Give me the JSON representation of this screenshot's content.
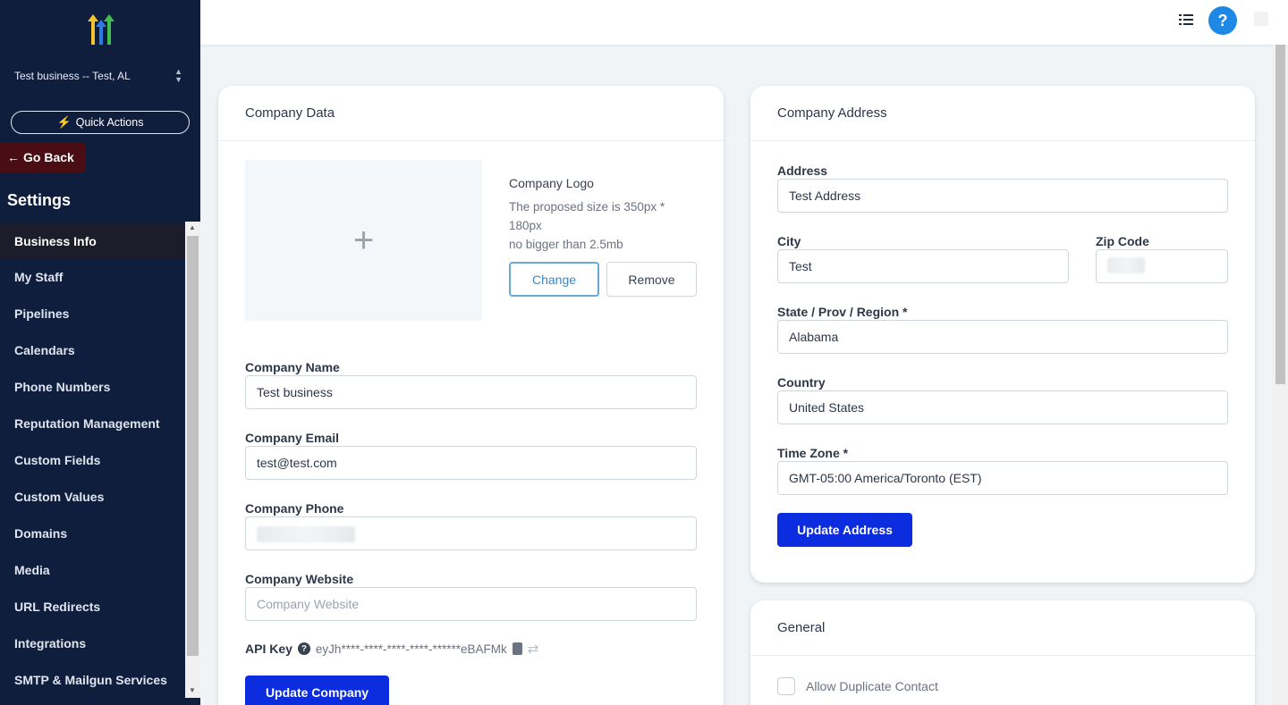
{
  "sidebar": {
    "account_name": "Test business -- Test, AL",
    "quick_actions_label": "Quick Actions",
    "go_back_label": "Go Back",
    "section_title": "Settings",
    "items": [
      {
        "label": "Business Info",
        "active": true
      },
      {
        "label": "My Staff"
      },
      {
        "label": "Pipelines"
      },
      {
        "label": "Calendars"
      },
      {
        "label": "Phone Numbers"
      },
      {
        "label": "Reputation Management"
      },
      {
        "label": "Custom Fields"
      },
      {
        "label": "Custom Values"
      },
      {
        "label": "Domains"
      },
      {
        "label": "Media"
      },
      {
        "label": "URL Redirects"
      },
      {
        "label": "Integrations"
      },
      {
        "label": "SMTP & Mailgun Services"
      }
    ]
  },
  "topbar": {
    "help_label": "?"
  },
  "company_data": {
    "title": "Company Data",
    "logo_label": "Company Logo",
    "logo_hint_line1": "The proposed size is 350px * 180px",
    "logo_hint_line2": "no bigger than 2.5mb",
    "change_label": "Change",
    "remove_label": "Remove",
    "name_label": "Company Name",
    "name_value": "Test business",
    "email_label": "Company Email",
    "email_value": "test@test.com",
    "phone_label": "Company Phone",
    "website_label": "Company Website",
    "website_placeholder": "Company Website",
    "api_key_label": "API Key",
    "api_key_value": "eyJh****-****-****-****-******eBAFMk",
    "update_label": "Update Company"
  },
  "company_address": {
    "title": "Company Address",
    "address_label": "Address",
    "address_value": "Test Address",
    "city_label": "City",
    "city_value": "Test",
    "zip_label": "Zip Code",
    "state_label": "State / Prov / Region *",
    "state_value": "Alabama",
    "country_label": "Country",
    "country_value": "United States",
    "timezone_label": "Time Zone *",
    "timezone_value": "GMT-05:00 America/Toronto (EST)",
    "update_label": "Update Address"
  },
  "general": {
    "title": "General",
    "allow_duplicate_label": "Allow Duplicate Contact"
  },
  "colors": {
    "sidebar_bg": "#0f1e3d",
    "primary_button": "#0c2cdf",
    "help_button": "#1e88e5"
  }
}
